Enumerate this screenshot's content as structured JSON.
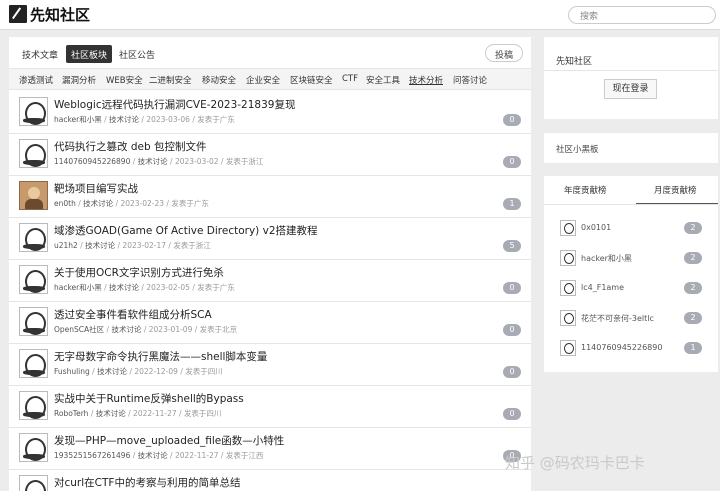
{
  "header": {
    "site_title": "先知社区",
    "search_placeholder": "搜索"
  },
  "tabs": [
    {
      "label": "技术文章"
    },
    {
      "label": "社区板块"
    },
    {
      "label": "社区公告"
    }
  ],
  "post_button": "投稿",
  "categories": [
    "渗透测试",
    "漏洞分析",
    "WEB安全",
    "二进制安全",
    "移动安全",
    "企业安全",
    "区块链安全",
    "CTF",
    "安全工具",
    "技术分析",
    "问答讨论"
  ],
  "posts": [
    {
      "title": "Weblogic远程代码执行漏洞CVE-2023-21839复现",
      "author": "hacker和小黑",
      "category": "技术讨论",
      "date": "2023-03-06",
      "location": "发表于广东",
      "count": "0"
    },
    {
      "title": "代码执行之篡改 deb 包控制文件",
      "author": "1140760945226890",
      "category": "技术讨论",
      "date": "2023-03-02",
      "location": "发表于浙江",
      "count": "0"
    },
    {
      "title": "靶场项目编写实战",
      "author": "en0th",
      "category": "技术讨论",
      "date": "2023-02-23",
      "location": "发表于广东",
      "count": "1"
    },
    {
      "title": "域渗透GOAD(Game Of Active Directory) v2搭建教程",
      "author": "u21h2",
      "category": "技术讨论",
      "date": "2023-02-17",
      "location": "发表于浙江",
      "count": "5"
    },
    {
      "title": "关于使用OCR文字识别方式进行免杀",
      "author": "hacker和小黑",
      "category": "技术讨论",
      "date": "2023-02-05",
      "location": "发表于广东",
      "count": "0"
    },
    {
      "title": "透过安全事件看软件组成分析SCA",
      "author": "OpenSCA社区",
      "category": "技术讨论",
      "date": "2023-01-09",
      "location": "发表于北京",
      "count": "0"
    },
    {
      "title": "无字母数字命令执行黑魔法——shell脚本变量",
      "author": "Fushuling",
      "category": "技术讨论",
      "date": "2022-12-09",
      "location": "发表于四川",
      "count": "0"
    },
    {
      "title": "实战中关于Runtime反弹shell的Bypass",
      "author": "RoboTerh",
      "category": "技术讨论",
      "date": "2022-11-27",
      "location": "发表于四川",
      "count": "0"
    },
    {
      "title": "发现—PHP—move_uploaded_file函数—小特性",
      "author": "1935251567261496",
      "category": "技术讨论",
      "date": "2022-11-27",
      "location": "发表于江西",
      "count": "0"
    },
    {
      "title": "对curl在CTF中的考察与利用的简单总结",
      "author": "",
      "category": "",
      "date": "",
      "location": "",
      "count": ""
    }
  ],
  "sidebar": {
    "community_title": "先知社区",
    "login_button": "现在登录",
    "blackboard_title": "社区小黑板",
    "rank_tabs": [
      "年度贡献榜",
      "月度贡献榜"
    ],
    "rank": [
      {
        "name": "0x0101",
        "count": "2"
      },
      {
        "name": "hacker和小黑",
        "count": "2"
      },
      {
        "name": "lc4_F1ame",
        "count": "2"
      },
      {
        "name": "花茫不可亲何-3eltlc",
        "count": "2"
      },
      {
        "name": "1140760945226890",
        "count": "1"
      }
    ]
  },
  "watermark": "知乎 @码农玛卡巴卡",
  "colors": {
    "active_tab": "#333333",
    "badge": "#a8aab4",
    "background": "#ececec"
  }
}
